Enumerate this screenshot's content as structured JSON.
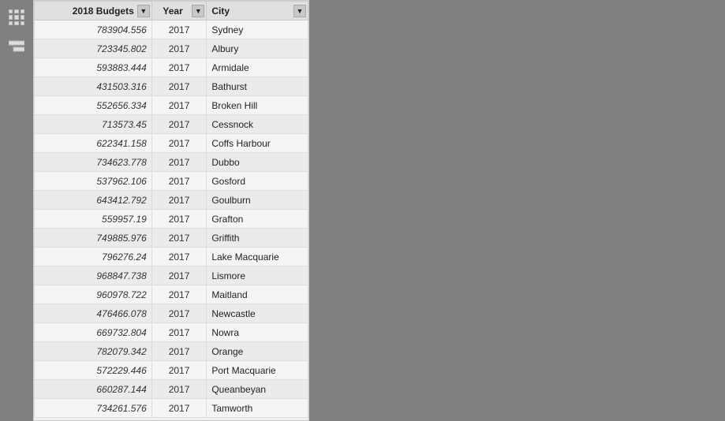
{
  "table": {
    "columns": [
      {
        "id": "budget",
        "label": "2018 Budgets"
      },
      {
        "id": "year",
        "label": "Year"
      },
      {
        "id": "city",
        "label": "City"
      }
    ],
    "rows": [
      {
        "budget": "783904.556",
        "year": "2017",
        "city": "Sydney"
      },
      {
        "budget": "723345.802",
        "year": "2017",
        "city": "Albury"
      },
      {
        "budget": "593883.444",
        "year": "2017",
        "city": "Armidale"
      },
      {
        "budget": "431503.316",
        "year": "2017",
        "city": "Bathurst"
      },
      {
        "budget": "552656.334",
        "year": "2017",
        "city": "Broken Hill"
      },
      {
        "budget": "713573.45",
        "year": "2017",
        "city": "Cessnock"
      },
      {
        "budget": "622341.158",
        "year": "2017",
        "city": "Coffs Harbour"
      },
      {
        "budget": "734623.778",
        "year": "2017",
        "city": "Dubbo"
      },
      {
        "budget": "537962.106",
        "year": "2017",
        "city": "Gosford"
      },
      {
        "budget": "643412.792",
        "year": "2017",
        "city": "Goulburn"
      },
      {
        "budget": "559957.19",
        "year": "2017",
        "city": "Grafton"
      },
      {
        "budget": "749885.976",
        "year": "2017",
        "city": "Griffith"
      },
      {
        "budget": "796276.24",
        "year": "2017",
        "city": "Lake Macquarie"
      },
      {
        "budget": "968847.738",
        "year": "2017",
        "city": "Lismore"
      },
      {
        "budget": "960978.722",
        "year": "2017",
        "city": "Maitland"
      },
      {
        "budget": "476466.078",
        "year": "2017",
        "city": "Newcastle"
      },
      {
        "budget": "669732.804",
        "year": "2017",
        "city": "Nowra"
      },
      {
        "budget": "782079.342",
        "year": "2017",
        "city": "Orange"
      },
      {
        "budget": "572229.446",
        "year": "2017",
        "city": "Port Macquarie"
      },
      {
        "budget": "660287.144",
        "year": "2017",
        "city": "Queanbeyan"
      },
      {
        "budget": "734261.576",
        "year": "2017",
        "city": "Tamworth"
      }
    ]
  },
  "icons": {
    "grid_icon": "⊞",
    "hierarchy_icon": "⊟"
  }
}
